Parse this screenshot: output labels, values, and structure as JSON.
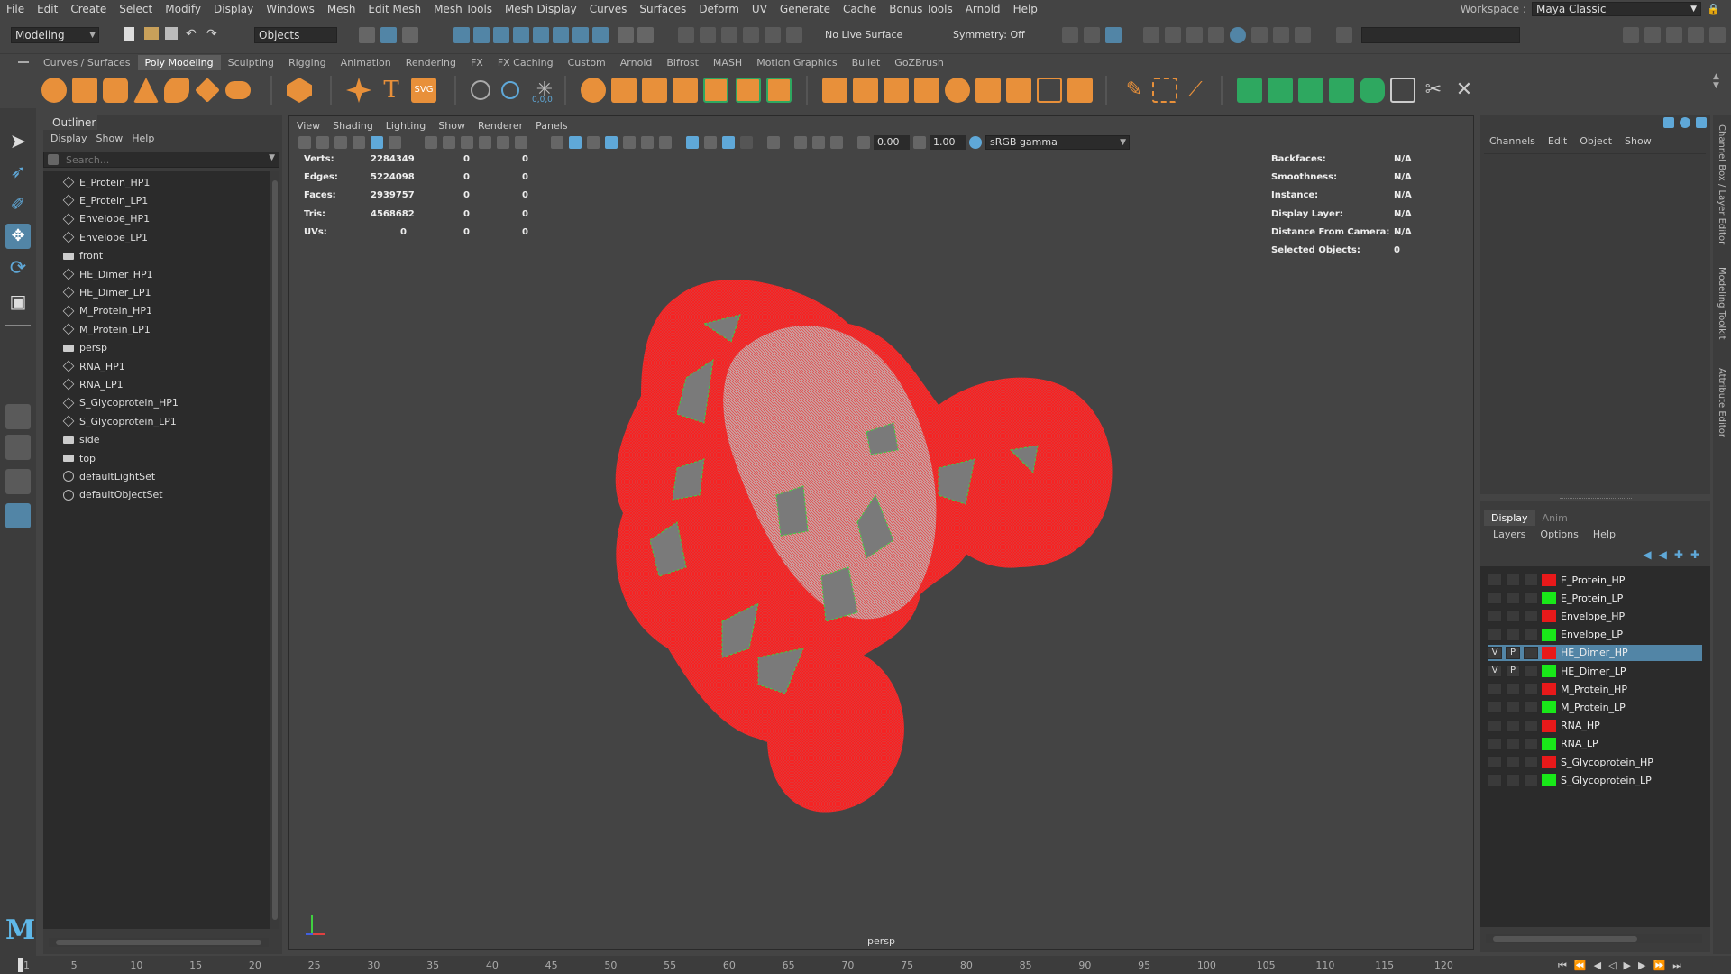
{
  "menubar": {
    "items": [
      "File",
      "Edit",
      "Create",
      "Select",
      "Modify",
      "Display",
      "Windows",
      "Mesh",
      "Edit Mesh",
      "Mesh Tools",
      "Mesh Display",
      "Curves",
      "Surfaces",
      "Deform",
      "UV",
      "Generate",
      "Cache",
      "Bonus Tools",
      "Arnold",
      "Help"
    ],
    "workspace_label": "Workspace :",
    "workspace_value": "Maya Classic"
  },
  "statusline": {
    "menuset": "Modeling",
    "selection_mode": "Objects",
    "live_surface": "No Live Surface",
    "symmetry": "Symmetry: Off"
  },
  "shelf": {
    "tabs": [
      "Curves / Surfaces",
      "Poly Modeling",
      "Sculpting",
      "Rigging",
      "Animation",
      "Rendering",
      "FX",
      "FX Caching",
      "Custom",
      "Arnold",
      "Bifrost",
      "MASH",
      "Motion Graphics",
      "Bullet",
      "GoZBrush"
    ],
    "active_tab": "Poly Modeling",
    "xyz_readout": "0,0,0"
  },
  "outliner": {
    "title": "Outliner",
    "menu": [
      "Display",
      "Show",
      "Help"
    ],
    "search_placeholder": "Search...",
    "items": [
      {
        "label": "E_Protein_HP1",
        "type": "mesh"
      },
      {
        "label": "E_Protein_LP1",
        "type": "mesh"
      },
      {
        "label": "Envelope_HP1",
        "type": "mesh"
      },
      {
        "label": "Envelope_LP1",
        "type": "mesh"
      },
      {
        "label": "front",
        "type": "camera"
      },
      {
        "label": "HE_Dimer_HP1",
        "type": "mesh"
      },
      {
        "label": "HE_Dimer_LP1",
        "type": "mesh"
      },
      {
        "label": "M_Protein_HP1",
        "type": "mesh"
      },
      {
        "label": "M_Protein_LP1",
        "type": "mesh"
      },
      {
        "label": "persp",
        "type": "camera"
      },
      {
        "label": "RNA_HP1",
        "type": "mesh"
      },
      {
        "label": "RNA_LP1",
        "type": "mesh"
      },
      {
        "label": "S_Glycoprotein_HP1",
        "type": "mesh"
      },
      {
        "label": "S_Glycoprotein_LP1",
        "type": "mesh"
      },
      {
        "label": "side",
        "type": "camera"
      },
      {
        "label": "top",
        "type": "camera"
      },
      {
        "label": "defaultLightSet",
        "type": "set"
      },
      {
        "label": "defaultObjectSet",
        "type": "set"
      }
    ]
  },
  "viewport": {
    "menu": [
      "View",
      "Shading",
      "Lighting",
      "Show",
      "Renderer",
      "Panels"
    ],
    "exposure": "0.00",
    "gamma": "1.00",
    "color_space": "sRGB gamma",
    "camera_label": "persp",
    "hud_left": [
      {
        "label": "Verts:",
        "v1": "2284349",
        "v2": "0",
        "v3": "0"
      },
      {
        "label": "Edges:",
        "v1": "5224098",
        "v2": "0",
        "v3": "0"
      },
      {
        "label": "Faces:",
        "v1": "2939757",
        "v2": "0",
        "v3": "0"
      },
      {
        "label": "Tris:",
        "v1": "4568682",
        "v2": "0",
        "v3": "0"
      },
      {
        "label": "UVs:",
        "v1": "0",
        "v2": "0",
        "v3": "0"
      }
    ],
    "hud_right": [
      {
        "label": "Backfaces:",
        "value": "N/A"
      },
      {
        "label": "Smoothness:",
        "value": "N/A"
      },
      {
        "label": "Instance:",
        "value": "N/A"
      },
      {
        "label": "Display Layer:",
        "value": "N/A"
      },
      {
        "label": "Distance From Camera:",
        "value": "N/A"
      },
      {
        "label": "Selected Objects:",
        "value": "0"
      }
    ]
  },
  "channelbox": {
    "menu": [
      "Channels",
      "Edit",
      "Object",
      "Show"
    ]
  },
  "layereditor": {
    "tabs": [
      "Display",
      "Anim"
    ],
    "active_tab": "Display",
    "menu": [
      "Layers",
      "Options",
      "Help"
    ],
    "layers": [
      {
        "name": "E_Protein_HP",
        "color": "#e8191a",
        "v": "",
        "p": "",
        "selected": false
      },
      {
        "name": "E_Protein_LP",
        "color": "#19e819",
        "v": "",
        "p": "",
        "selected": false
      },
      {
        "name": "Envelope_HP",
        "color": "#e8191a",
        "v": "",
        "p": "",
        "selected": false
      },
      {
        "name": "Envelope_LP",
        "color": "#19e819",
        "v": "",
        "p": "",
        "selected": false
      },
      {
        "name": "HE_Dimer_HP",
        "color": "#e8191a",
        "v": "V",
        "p": "P",
        "selected": true
      },
      {
        "name": "HE_Dimer_LP",
        "color": "#19e819",
        "v": "V",
        "p": "P",
        "selected": false
      },
      {
        "name": "M_Protein_HP",
        "color": "#e8191a",
        "v": "",
        "p": "",
        "selected": false
      },
      {
        "name": "M_Protein_LP",
        "color": "#19e819",
        "v": "",
        "p": "",
        "selected": false
      },
      {
        "name": "RNA_HP",
        "color": "#e8191a",
        "v": "",
        "p": "",
        "selected": false
      },
      {
        "name": "RNA_LP",
        "color": "#19e819",
        "v": "",
        "p": "",
        "selected": false
      },
      {
        "name": "S_Glycoprotein_HP",
        "color": "#e8191a",
        "v": "",
        "p": "",
        "selected": false
      },
      {
        "name": "S_Glycoprotein_LP",
        "color": "#19e819",
        "v": "",
        "p": "",
        "selected": false
      }
    ]
  },
  "sidetabs": [
    "Channel Box / Layer Editor",
    "Modeling Toolkit",
    "Attribute Editor"
  ],
  "timeline": {
    "ticks": [
      "1",
      "5",
      "10",
      "15",
      "20",
      "25",
      "30",
      "35",
      "40",
      "45",
      "50",
      "55",
      "60",
      "65",
      "70",
      "75",
      "80",
      "85",
      "90",
      "95",
      "100",
      "105",
      "110",
      "115",
      "120"
    ]
  },
  "colors": {
    "accent": "#5285a6",
    "mesh_wire": "#ff2020",
    "shelf_icon": "#e8903a",
    "shelf_icon_green": "#2ea860"
  }
}
